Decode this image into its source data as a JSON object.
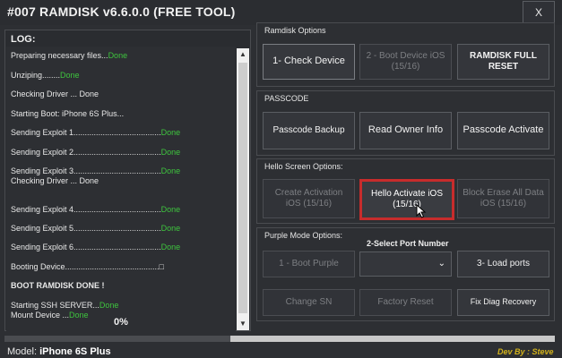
{
  "window": {
    "title": "#007 RAMDISK v6.6.0.0 (FREE TOOL)",
    "close_label": "X"
  },
  "log": {
    "header": "LOG:",
    "lines": [
      {
        "text": "Preparing necessary files...",
        "status": "Done"
      },
      {
        "text": "Unziping........",
        "status": "Done"
      },
      {
        "text": "Checking Driver  ... Done",
        "status": ""
      },
      {
        "text": "Starting  Boot: iPhone 6S Plus...",
        "status": ""
      },
      {
        "text": "Sending Exploit 1.......................................",
        "status": "Done"
      },
      {
        "text": "Sending Exploit 2.......................................",
        "status": "Done"
      },
      {
        "text": "Sending Exploit 3.......................................",
        "status": "Done"
      },
      {
        "text": "Checking Driver  ... Done",
        "status": ""
      },
      {
        "text": "Sending Exploit 4.......................................",
        "status": "Done"
      },
      {
        "text": "Sending Exploit 5.......................................",
        "status": "Done"
      },
      {
        "text": "Sending Exploit 6.......................................",
        "status": "Done"
      },
      {
        "text": "Booting Device..........................................□",
        "status": ""
      },
      {
        "text": "BOOT RAMDISK DONE !",
        "status": ""
      },
      {
        "text": " Starting SSH SERVER...",
        "status": "Done"
      },
      {
        "text": "Mount Device ...",
        "status": "Done"
      }
    ],
    "percent": "0%"
  },
  "ramdisk": {
    "title": "Ramdisk Options",
    "check_device": "1- Check Device",
    "boot_device": "2 - Boot Device iOS (15/16)",
    "full_reset": "RAMDISK FULL RESET"
  },
  "passcode": {
    "title": "PASSCODE",
    "backup": "Passcode Backup",
    "owner_info": "Read Owner Info",
    "activate": "Passcode Activate"
  },
  "hello": {
    "title": "Hello Screen Options:",
    "create_activation": "Create Activation iOS (15/16)",
    "hello_activate": "Hello Activate iOS (15/16)",
    "block_erase": "Block Erase All Data iOS (15/16)"
  },
  "purple": {
    "title": "Purple Mode Options:",
    "port_label": "2-Select Port Number",
    "boot_purple": "1 - Boot Purple",
    "port_value": "",
    "load_ports": "3- Load ports",
    "change_sn": "Change SN",
    "factory_reset": "Factory Reset",
    "fix_diag": "Fix Diag Recovery"
  },
  "status": {
    "model_label": "Model:",
    "model_value": "iPhone 6S Plus",
    "credit": "Dev By : Steve",
    "progress": 0.41
  }
}
